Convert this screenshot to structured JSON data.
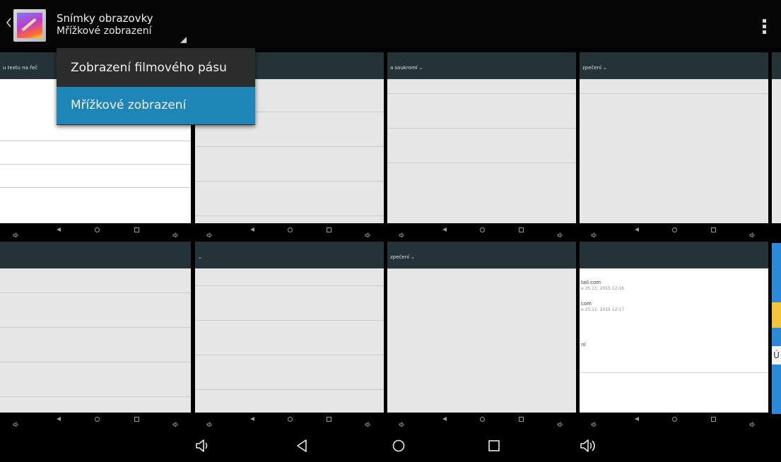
{
  "header": {
    "title": "Snímky obrazovky",
    "subtitle": "Mřížkové zobrazení",
    "back_icon": "chevron-left-icon",
    "app_icon": "gallery-icon",
    "overflow_icon": "overflow-menu-icon"
  },
  "dropdown": {
    "items": [
      {
        "label": "Zobrazení filmového pásu",
        "selected": false
      },
      {
        "label": "Mřížkové zobrazení",
        "selected": true
      }
    ],
    "selected_color": "#1d86b7"
  },
  "thumbnails": {
    "row1": [
      {
        "header_text": "u textu na řeč"
      },
      {
        "header_text": ""
      },
      {
        "header_text": "a soukromí ⌄"
      },
      {
        "header_text": "zpečení ⌄"
      }
    ],
    "row2": [
      {
        "header_text": ""
      },
      {
        "header_text": "⌄"
      },
      {
        "header_text": "zpečení ⌄"
      },
      {
        "header_text": ""
      }
    ],
    "row2_col4_lines": [
      "tail.com",
      "e 25.11. 2015 12:16",
      "com",
      "e 25.11. 2015 12:17",
      "ní"
    ],
    "partial_text": "Ú"
  },
  "navbar": {
    "icons": [
      "volume-down-icon",
      "back-icon",
      "home-icon",
      "recents-icon",
      "volume-up-icon"
    ]
  },
  "colors": {
    "actionbar": "#060606",
    "thumb_header": "#253237",
    "selected_item": "#1d86b7"
  }
}
